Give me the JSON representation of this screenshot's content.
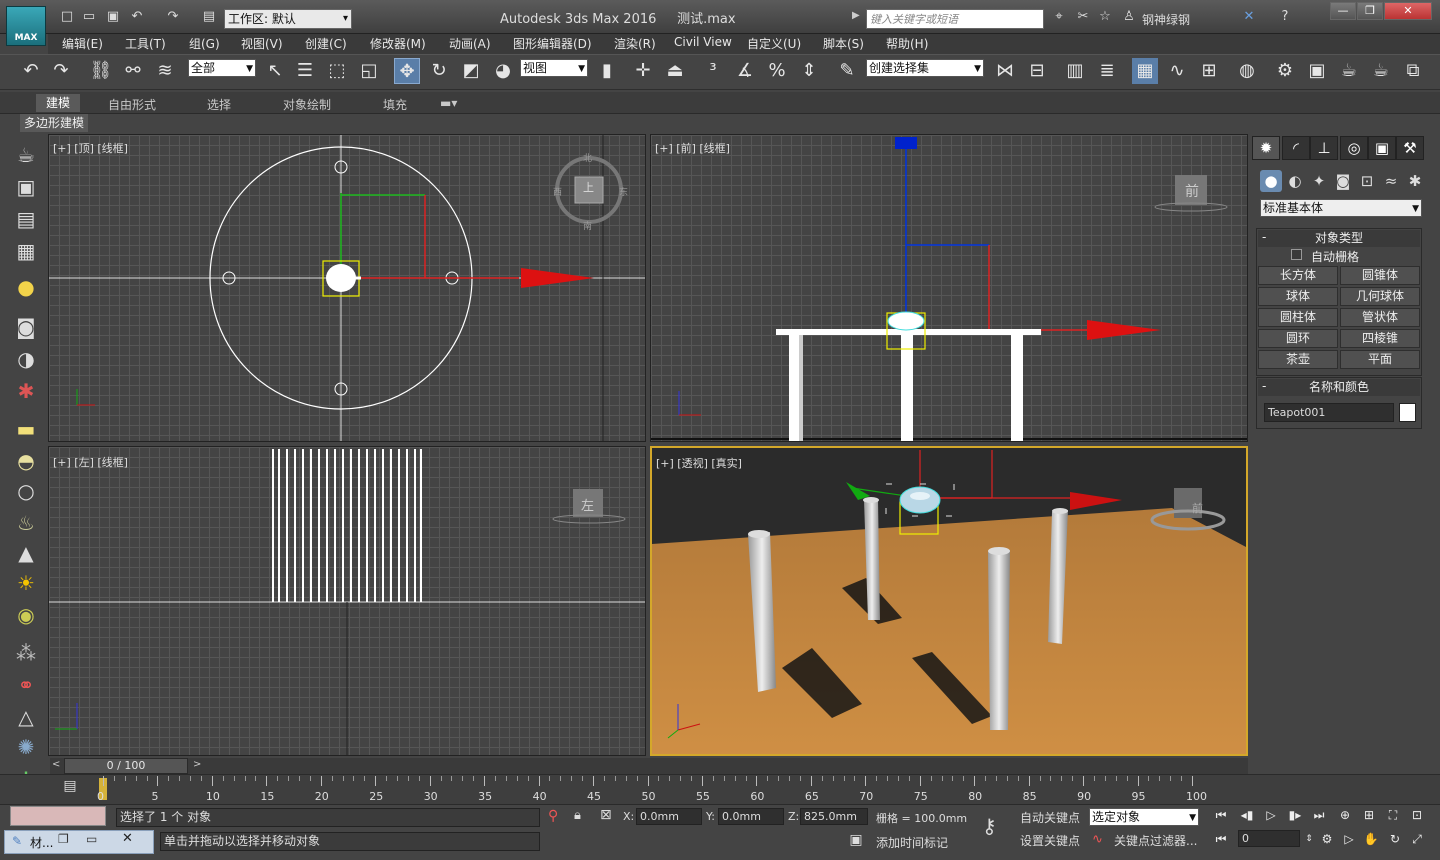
{
  "app": {
    "logo": "MAX",
    "title": "Autodesk 3ds Max 2016",
    "file": "测试.max",
    "workspace": "工作区: 默认",
    "search_placeholder": "键入关键字或短语",
    "user": "钢神绿钢"
  },
  "menus": [
    "编辑(E)",
    "工具(T)",
    "组(G)",
    "视图(V)",
    "创建(C)",
    "修改器(M)",
    "动画(A)",
    "图形编辑器(D)",
    "渲染(R)",
    "Civil View",
    "自定义(U)",
    "脚本(S)",
    "帮助(H)"
  ],
  "toolbar": {
    "selection_filter": "全部",
    "ref_coord": "视图",
    "named_selection": "创建选择集"
  },
  "ribbon": {
    "tabs": [
      "建模",
      "自由形式",
      "选择",
      "对象绘制",
      "填充"
    ],
    "sub": "多边形建模"
  },
  "viewports": {
    "top": "[+] [顶] [线框]",
    "front": "[+] [前] [线框]",
    "left": "[+] [左] [线框]",
    "persp": "[+] [透视] [真实]",
    "cube_top": "上",
    "cube_front": "前",
    "cube_left": "左",
    "cube_persp": "前",
    "compass_n": "北",
    "compass_s": "南",
    "compass_e": "东",
    "compass_w": "西"
  },
  "cmd_panel": {
    "category": "标准基本体",
    "object_type": "对象类型",
    "autogrid": "自动栅格",
    "buttons": [
      "长方体",
      "圆锥体",
      "球体",
      "几何球体",
      "圆柱体",
      "管状体",
      "圆环",
      "四棱锥",
      "茶壶",
      "平面"
    ],
    "name_color": "名称和颜色",
    "object_name": "Teapot001",
    "minus": "-"
  },
  "timeline": {
    "frame": "0 / 100",
    "ticks": [
      "0",
      "5",
      "10",
      "15",
      "20",
      "25",
      "30",
      "35",
      "40",
      "45",
      "50",
      "55",
      "60",
      "65",
      "70",
      "75",
      "80",
      "85",
      "90",
      "95",
      "100"
    ]
  },
  "status": {
    "selected": "选择了 1 个 对象",
    "prompt": "单击并拖动以选择并移动对象",
    "x": "0.0mm",
    "y": "0.0mm",
    "z": "825.0mm",
    "grid": "栅格 = 100.0mm",
    "add_time_tag": "添加时间标记",
    "autokey": "自动关键点",
    "setkey": "设置关键点",
    "key_mode": "选定对象",
    "key_filter": "关键点过滤器...",
    "frame_field": "0",
    "x_label": "X:",
    "y_label": "Y:",
    "z_label": "Z:",
    "taskbar_item": "材..."
  }
}
